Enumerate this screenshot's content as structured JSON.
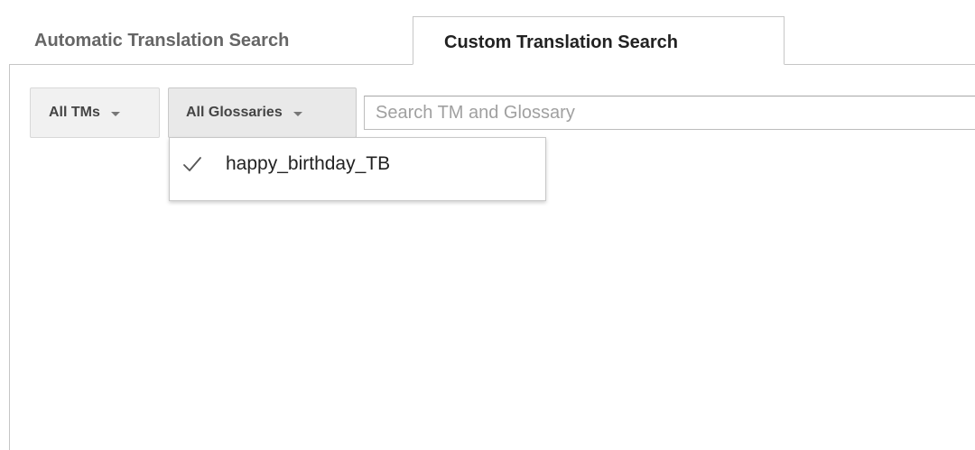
{
  "tabs": [
    {
      "label": "Automatic Translation Search",
      "active": false
    },
    {
      "label": "Custom Translation Search",
      "active": true
    }
  ],
  "toolbar": {
    "tm_filter_label": "All TMs",
    "glossary_filter_label": "All Glossaries",
    "search_placeholder": "Search TM and Glossary",
    "search_value": ""
  },
  "glossary_menu": {
    "items": [
      {
        "label": "happy_birthday_TB",
        "checked": true,
        "icon": "checkmark-icon"
      }
    ]
  },
  "colors": {
    "border": "#c6c6c6",
    "button_bg": "#f1f1f1",
    "active_button_bg": "#e9e9e9",
    "placeholder": "#a0a0a0"
  }
}
